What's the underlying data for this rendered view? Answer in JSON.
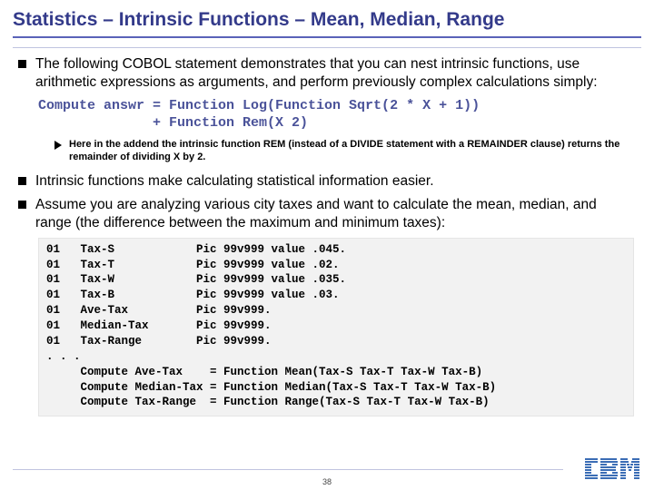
{
  "title": "Statistics – Intrinsic Functions – Mean, Median, Range",
  "bullets": {
    "b1": "The following COBOL statement demonstrates that you can nest intrinsic functions, use arithmetic expressions as arguments, and perform previously complex calculations simply:",
    "b2": "Intrinsic functions make calculating statistical information easier.",
    "b3": "Assume you are analyzing various city taxes and want to calculate the mean, median, and range (the difference between the maximum and minimum taxes):"
  },
  "code1": {
    "l1": "Compute answr = Function Log(Function Sqrt(2 * X + 1))",
    "l2": "              + Function Rem(X 2)"
  },
  "note": "Here in the addend the intrinsic function REM (instead of a DIVIDE statement with a REMAINDER clause) returns the remainder of dividing X by 2.",
  "codebox": {
    "r1": "01   Tax-S            Pic 99v999 value .045.",
    "r2": "01   Tax-T            Pic 99v999 value .02.",
    "r3": "01   Tax-W            Pic 99v999 value .035.",
    "r4": "01   Tax-B            Pic 99v999 value .03.",
    "r5": "01   Ave-Tax          Pic 99v999.",
    "r6": "01   Median-Tax       Pic 99v999.",
    "r7": "01   Tax-Range        Pic 99v999.",
    "r8": ". . .",
    "r9": "     Compute Ave-Tax    = Function Mean(Tax-S Tax-T Tax-W Tax-B)",
    "r10": "     Compute Median-Tax = Function Median(Tax-S Tax-T Tax-W Tax-B)",
    "r11": "     Compute Tax-Range  = Function Range(Tax-S Tax-T Tax-W Tax-B)"
  },
  "pagenum": "38"
}
